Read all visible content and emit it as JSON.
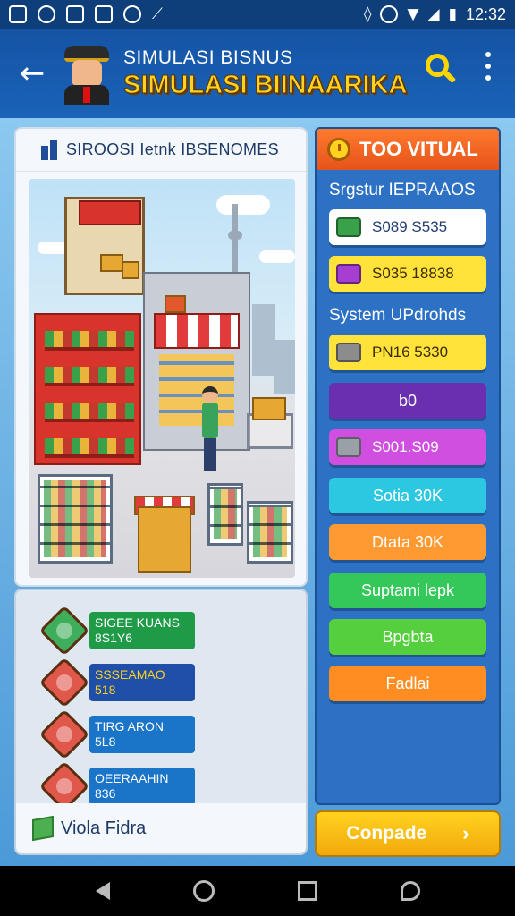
{
  "status_bar": {
    "time": "12:32"
  },
  "header": {
    "subtitle": "SIMULASI BISNUS",
    "title": "SIMULASI BIINAARIKA"
  },
  "scene_panel": {
    "header": "SIROOSI Ietnk IBSENOMES"
  },
  "stats": [
    {
      "line1": "SIGEE KUANS",
      "line2": "8S1Y6",
      "gem_color": "#3fae5a",
      "label_color": "#1f9b48"
    },
    {
      "line1": "SSSEAMAO",
      "line2": "518",
      "gem_color": "#e0574b",
      "label_color": "#1f4fa8"
    },
    {
      "line1": "TIRG ARON",
      "line2": "5L8",
      "gem_color": "#e0574b",
      "label_color": "#1a75c8"
    },
    {
      "line1": "OEERAAHIN",
      "line2": "836",
      "gem_color": "#e0574b",
      "label_color": "#1a75c8"
    }
  ],
  "footer": {
    "label": "Viola Fidra"
  },
  "right_panel": {
    "header": "TOO VITUAL",
    "section1": "Srgstur IEPRAAOS",
    "section2": "System UPdrohds",
    "buttons": [
      {
        "label": "S089 S535",
        "bg": "#ffffff",
        "fg": "#1f3c73",
        "icon": "#3aa14b"
      },
      {
        "label": "S035 18838",
        "bg": "#ffe23a",
        "fg": "#3d2a00",
        "icon": "#a63fd1"
      },
      {
        "label": "PN16 5330",
        "bg": "#ffe23a",
        "fg": "#3d2a00",
        "icon": "#8c8c8c"
      },
      {
        "label": "b0",
        "bg": "#6a2fb0",
        "fg": "#ffffff",
        "icon": ""
      },
      {
        "label": "S001.S09",
        "bg": "#d04ee0",
        "fg": "#ffffff",
        "icon": "#9aa0a8"
      },
      {
        "label": "Sotia 30K",
        "bg": "#2cc7e0",
        "fg": "#ffffff",
        "icon": ""
      },
      {
        "label": "Dtata 30K",
        "bg": "#ff9a33",
        "fg": "#ffffff",
        "icon": ""
      },
      {
        "label": "Suptami lepk",
        "bg": "#34c759",
        "fg": "#ffffff",
        "icon": ""
      },
      {
        "label": "Bpgbta",
        "bg": "#55cf3e",
        "fg": "#ffffff",
        "icon": ""
      },
      {
        "label": "Fadlai",
        "bg": "#ff8d22",
        "fg": "#ffffff",
        "icon": ""
      }
    ]
  },
  "cta": {
    "label": "Conpade"
  }
}
